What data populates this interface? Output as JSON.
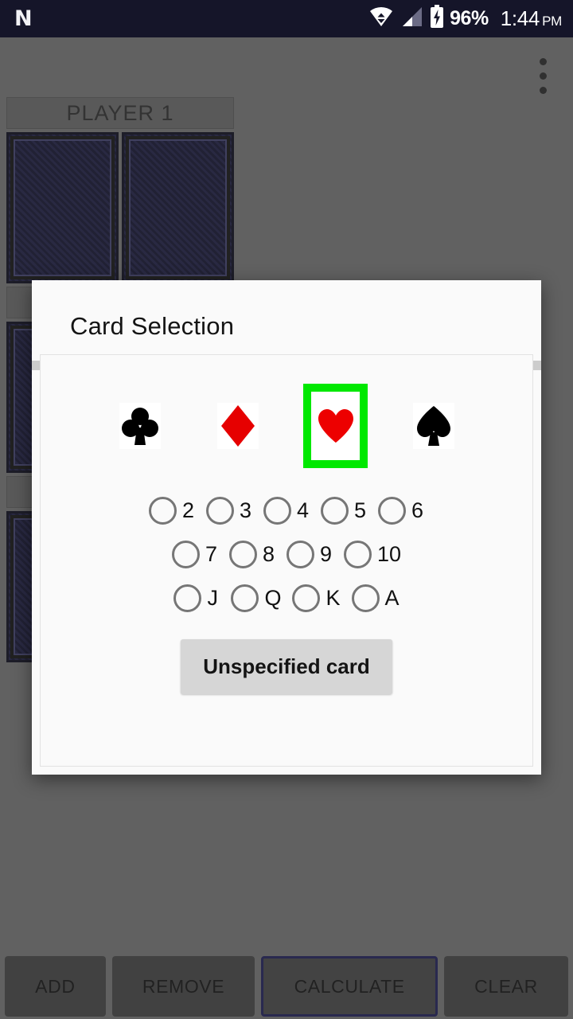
{
  "statusbar": {
    "logo": "N",
    "logo_icon": "android-n-logo-icon",
    "wifi_icon": "wifi-icon",
    "signal_icon": "cellular-signal-icon",
    "battery_icon": "battery-charging-icon",
    "battery_percent": "96%",
    "time": "1:44",
    "ampm": "PM"
  },
  "appbar": {
    "overflow_icon": "more-vertical-icon"
  },
  "background": {
    "players": [
      {
        "label": "PLAYER 1",
        "cards": [
          "card-back",
          "card-back"
        ]
      },
      {
        "label": "",
        "cards": [
          "card-back"
        ]
      },
      {
        "label": "",
        "cards": [
          "card-back"
        ]
      }
    ]
  },
  "dialog": {
    "title": "Card Selection",
    "suits": [
      {
        "name": "clubs",
        "glyph": "♣",
        "color": "#000000",
        "selected": false,
        "icon": "club-suit-icon"
      },
      {
        "name": "diamonds",
        "glyph": "♦",
        "color": "#e60000",
        "selected": false,
        "icon": "diamond-suit-icon"
      },
      {
        "name": "hearts",
        "glyph": "♥",
        "color": "#e60000",
        "selected": true,
        "icon": "heart-suit-icon"
      },
      {
        "name": "spades",
        "glyph": "♠",
        "color": "#000000",
        "selected": false,
        "icon": "spade-suit-icon"
      }
    ],
    "selection_color": "#00e800",
    "rank_rows": [
      [
        {
          "label": "2",
          "checked": false
        },
        {
          "label": "3",
          "checked": false
        },
        {
          "label": "4",
          "checked": false
        },
        {
          "label": "5",
          "checked": false
        },
        {
          "label": "6",
          "checked": false
        }
      ],
      [
        {
          "label": "7",
          "checked": false
        },
        {
          "label": "8",
          "checked": false
        },
        {
          "label": "9",
          "checked": false
        },
        {
          "label": "10",
          "checked": false
        }
      ],
      [
        {
          "label": "J",
          "checked": false
        },
        {
          "label": "Q",
          "checked": false
        },
        {
          "label": "K",
          "checked": false
        },
        {
          "label": "A",
          "checked": false
        }
      ]
    ],
    "unspecified_label": "Unspecified card"
  },
  "bottombar": {
    "buttons": [
      {
        "label": "ADD",
        "focused": false
      },
      {
        "label": "REMOVE",
        "focused": false
      },
      {
        "label": "CALCULATE",
        "focused": true
      },
      {
        "label": "CLEAR",
        "focused": false
      }
    ],
    "focus_border_color": "#2b2b7a"
  }
}
